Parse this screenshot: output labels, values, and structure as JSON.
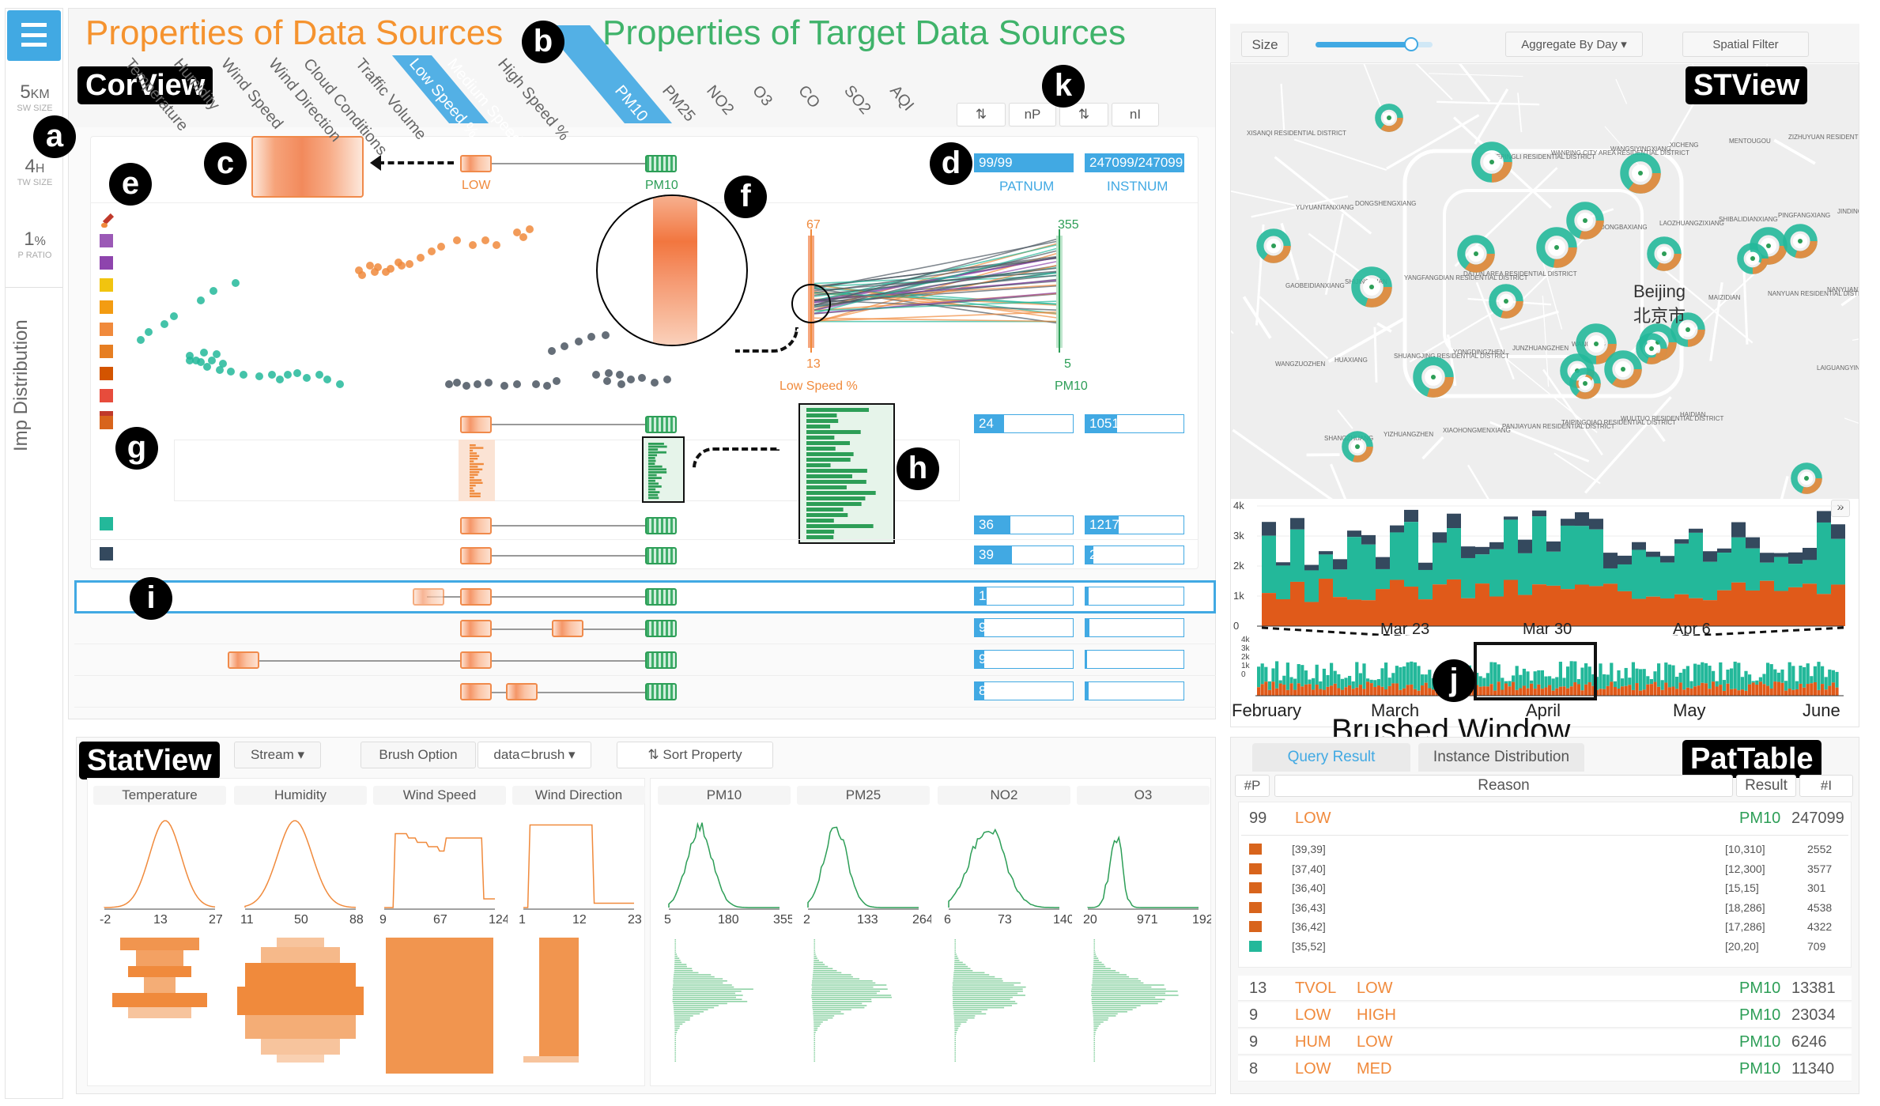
{
  "titles": {
    "sources": "Properties of Data Sources",
    "targets": "Properties of Target Data Sources",
    "corview": "CorView",
    "stview": "STView",
    "statview": "StatView",
    "pattable": "PatTable",
    "brushed": "Brushed Window"
  },
  "badges": [
    "a",
    "b",
    "c",
    "d",
    "e",
    "f",
    "g",
    "h",
    "i",
    "j",
    "k"
  ],
  "left": {
    "menu_icon": "hamburger-icon",
    "sw": {
      "value": "5",
      "unit": "KM",
      "label": "SW SIZE"
    },
    "tw": {
      "value": "4",
      "unit": "H",
      "label": "TW SIZE"
    },
    "p": {
      "value": "1",
      "unit": "%",
      "label": "P RATIO"
    },
    "imp": "Imp Distribution"
  },
  "source_props": [
    "Temperature",
    "Humidity",
    "Wind Speed",
    "Wind Direction",
    "Cloud Conditions",
    "Traffic Volume",
    "Low Speed %",
    "Medium Speed %",
    "High Speed %"
  ],
  "target_props": [
    "PM10",
    "PM25",
    "NO2",
    "O3",
    "CO",
    "SO2",
    "AQI"
  ],
  "sort": {
    "np": "nP",
    "ni": "nI",
    "sort_icon": "sort-icon"
  },
  "cor": {
    "low": "LOW",
    "pm10": "PM10",
    "patnum_value": "99/99",
    "instnum_value": "247099/247099",
    "patnum_label": "PATNUM",
    "instnum_label": "INSTNUM",
    "axis_left_max": "67",
    "axis_left_min": "13",
    "axis_right_max": "355",
    "axis_right_min": "5",
    "axis_left_label": "Low Speed %",
    "axis_right_label": "PM10",
    "brush_icon": "paintbrush-icon"
  },
  "rows": [
    {
      "p": "24",
      "i": "105101",
      "pf": 0.3
    },
    {
      "p": "36",
      "i": "121778",
      "pf": 0.36
    },
    {
      "p": "39",
      "i": "20220",
      "pf": 0.38
    },
    {
      "p": "13/13",
      "i": "13381/13381",
      "pf": 0.12
    },
    {
      "p": "9/9",
      "i": "23034/23034",
      "pf": 0.1
    },
    {
      "p": "9/9",
      "i": "6246/6246",
      "pf": 0.1
    },
    {
      "p": "8/8",
      "i": "11340/11340",
      "pf": 0.1
    }
  ],
  "map": {
    "size": "Size",
    "aggregate": "Aggregate By Day",
    "filter": "Spatial Filter",
    "slider": 0.82,
    "city": "Beijing",
    "city_cn": "北京市",
    "districts": [
      "XISANQI RESIDENTIAL DISTRICT",
      "DONGSHENGXIANG",
      "DATUN AREA RESIDENTIAL DISTRICT",
      "WANGJING",
      "HAIDIAN",
      "ZIZHUYUAN RESIDENTIAL DISTRICT",
      "YUYUANTANXIANG",
      "YANGFANGDIAN RESIDENTIAL DISTRICT",
      "JUNZHUANGZHEN",
      "WULITUO RESIDENTIAL DISTRICT",
      "MENTOUGOU",
      "JINDING STREET RESIDENTIAL",
      "SHIJINGSHAN",
      "YONGDINGZHEN",
      "TAIPINGQIAO RESIDENTIAL DISTRICT",
      "XICHENG",
      "PINGFANGXIANG",
      "GAOBEIDIANXIANG",
      "SHUANGJING RESIDENTIAL DISTRICT",
      "PANJIAYUAN RESIDENTIAL DISTRICT",
      "WANGSIYINGXIANG",
      "SHIBALIDIANXIANG",
      "NANYUANXIANG",
      "HUAXIANG",
      "XIAOHONGMENXIANG",
      "WANPING CITY AREA RESIDENTIAL DISTRICT",
      "LAOZHUANGZIXIANG",
      "NANYUAN RESIDENTIAL DISTRICT",
      "WANGZUOZHEN",
      "YIZHUANGZHEN",
      "HEPINGLI RESIDENTIAL DISTRICT",
      "DONGBAXIANG",
      "MAIZIDIAN",
      "LAIGUANGYING",
      "SHANGZHUANG"
    ]
  },
  "timeline": {
    "detail_y": [
      "4k",
      "3k",
      "2k",
      "1k",
      "0"
    ],
    "detail_x": [
      "Mar 23",
      "Mar 30",
      "Apr 6"
    ],
    "overview_y": [
      "4k",
      "3k",
      "2k",
      "1k",
      "0"
    ],
    "overview_x": [
      "February",
      "March",
      "April",
      "May",
      "June"
    ],
    "expand_icon": "double-chevron-down-icon"
  },
  "stat": {
    "stream": "Stream",
    "brush_option": "Brush Option",
    "brush_value": "data⊂brush",
    "sort": "Sort",
    "property": "Property",
    "charts": [
      {
        "name": "Temperature",
        "ticks": [
          "-2",
          "13",
          "27"
        ]
      },
      {
        "name": "Humidity",
        "ticks": [
          "11",
          "50",
          "88"
        ]
      },
      {
        "name": "Wind Speed",
        "ticks": [
          "9",
          "67",
          "124"
        ]
      },
      {
        "name": "Wind Direction",
        "ticks": [
          "1",
          "12",
          "23"
        ]
      },
      {
        "name": "PM10",
        "ticks": [
          "5",
          "180",
          "355"
        ]
      },
      {
        "name": "PM25",
        "ticks": [
          "2",
          "133",
          "264"
        ]
      },
      {
        "name": "NO2",
        "ticks": [
          "6",
          "73",
          "140"
        ]
      },
      {
        "name": "O3",
        "ticks": [
          "20",
          "971",
          "192"
        ]
      }
    ]
  },
  "pat": {
    "tab1": "Query Result",
    "tab2": "Instance Distribution",
    "h_p": "#P",
    "h_reason": "Reason",
    "h_result": "Result",
    "h_i": "#I",
    "top": {
      "p": "99",
      "r1": "LOW",
      "res": "PM10",
      "i": "247099"
    },
    "sub": [
      {
        "l": "[39,39]",
        "r": "[10,310]",
        "n": "2552",
        "c": "#d8641c"
      },
      {
        "l": "[37,40]",
        "r": "[12,300]",
        "n": "3577",
        "c": "#d8641c"
      },
      {
        "l": "[36,40]",
        "r": "[15,15]",
        "n": "301",
        "c": "#d8641c"
      },
      {
        "l": "[36,43]",
        "r": "[18,286]",
        "n": "4538",
        "c": "#d8641c"
      },
      {
        "l": "[36,42]",
        "r": "[17,286]",
        "n": "4322",
        "c": "#d8641c"
      },
      {
        "l": "[35,52]",
        "r": "[20,20]",
        "n": "709",
        "c": "#23b89a"
      }
    ],
    "rows": [
      {
        "p": "13",
        "r1": "TVOL",
        "r2": "LOW",
        "res": "PM10",
        "i": "13381"
      },
      {
        "p": "9",
        "r1": "LOW",
        "r2": "HIGH",
        "res": "PM10",
        "i": "23034"
      },
      {
        "p": "9",
        "r1": "HUM",
        "r2": "LOW",
        "res": "PM10",
        "i": "6246"
      },
      {
        "p": "8",
        "r1": "LOW",
        "r2": "MED",
        "res": "PM10",
        "i": "11340"
      }
    ]
  },
  "colors": {
    "accent": "#41a9e3",
    "orange": "#f08a3c",
    "green": "#2d9e57",
    "teal": "#23b89a",
    "navy": "#34495e"
  }
}
